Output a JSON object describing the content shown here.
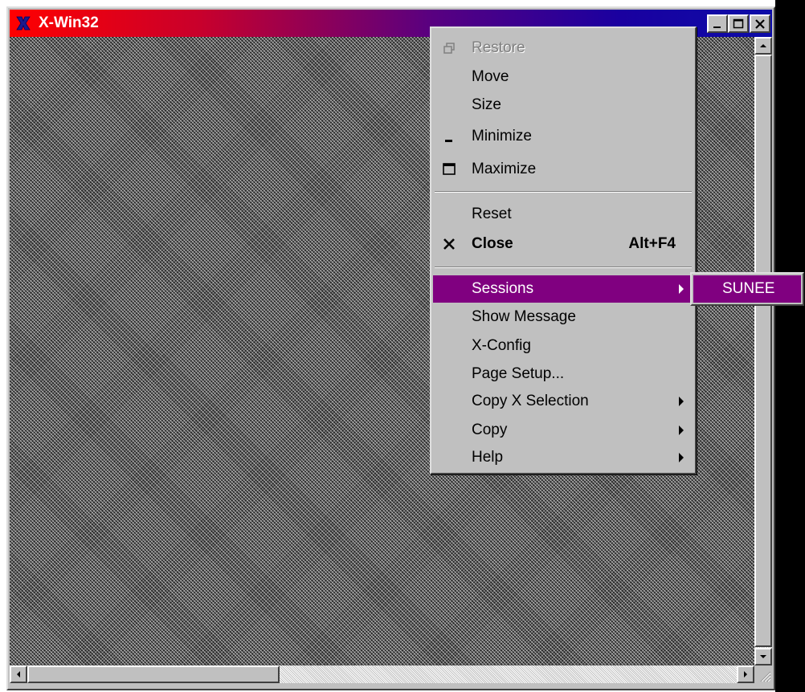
{
  "window": {
    "title": "X-Win32",
    "controls": [
      "minimize-icon",
      "maximize-icon",
      "close-icon"
    ]
  },
  "menu": {
    "items": [
      {
        "label": "Restore",
        "icon": "restore-icon",
        "disabled": true
      },
      {
        "label": "Move"
      },
      {
        "label": "Size"
      },
      {
        "label": "Minimize",
        "icon": "minimize-icon"
      },
      {
        "label": "Maximize",
        "icon": "maximize-icon"
      },
      {
        "label": "Reset"
      },
      {
        "label": "Close",
        "icon": "close-icon",
        "shortcut": "Alt+F4",
        "bold": true
      },
      {
        "label": "Sessions",
        "submenu": true,
        "highlighted": true
      },
      {
        "label": "Show Message"
      },
      {
        "label": "X-Config"
      },
      {
        "label": "Page Setup..."
      },
      {
        "label": "Copy X Selection",
        "submenu": true
      },
      {
        "label": "Copy",
        "submenu": true
      },
      {
        "label": "Help",
        "submenu": true
      }
    ]
  },
  "submenu": {
    "items": [
      {
        "label": "SUNEE",
        "highlighted": true
      }
    ]
  },
  "colors": {
    "highlight": "#800080",
    "titlebar_start": "#ff0000",
    "titlebar_end": "#0c0ca8"
  }
}
